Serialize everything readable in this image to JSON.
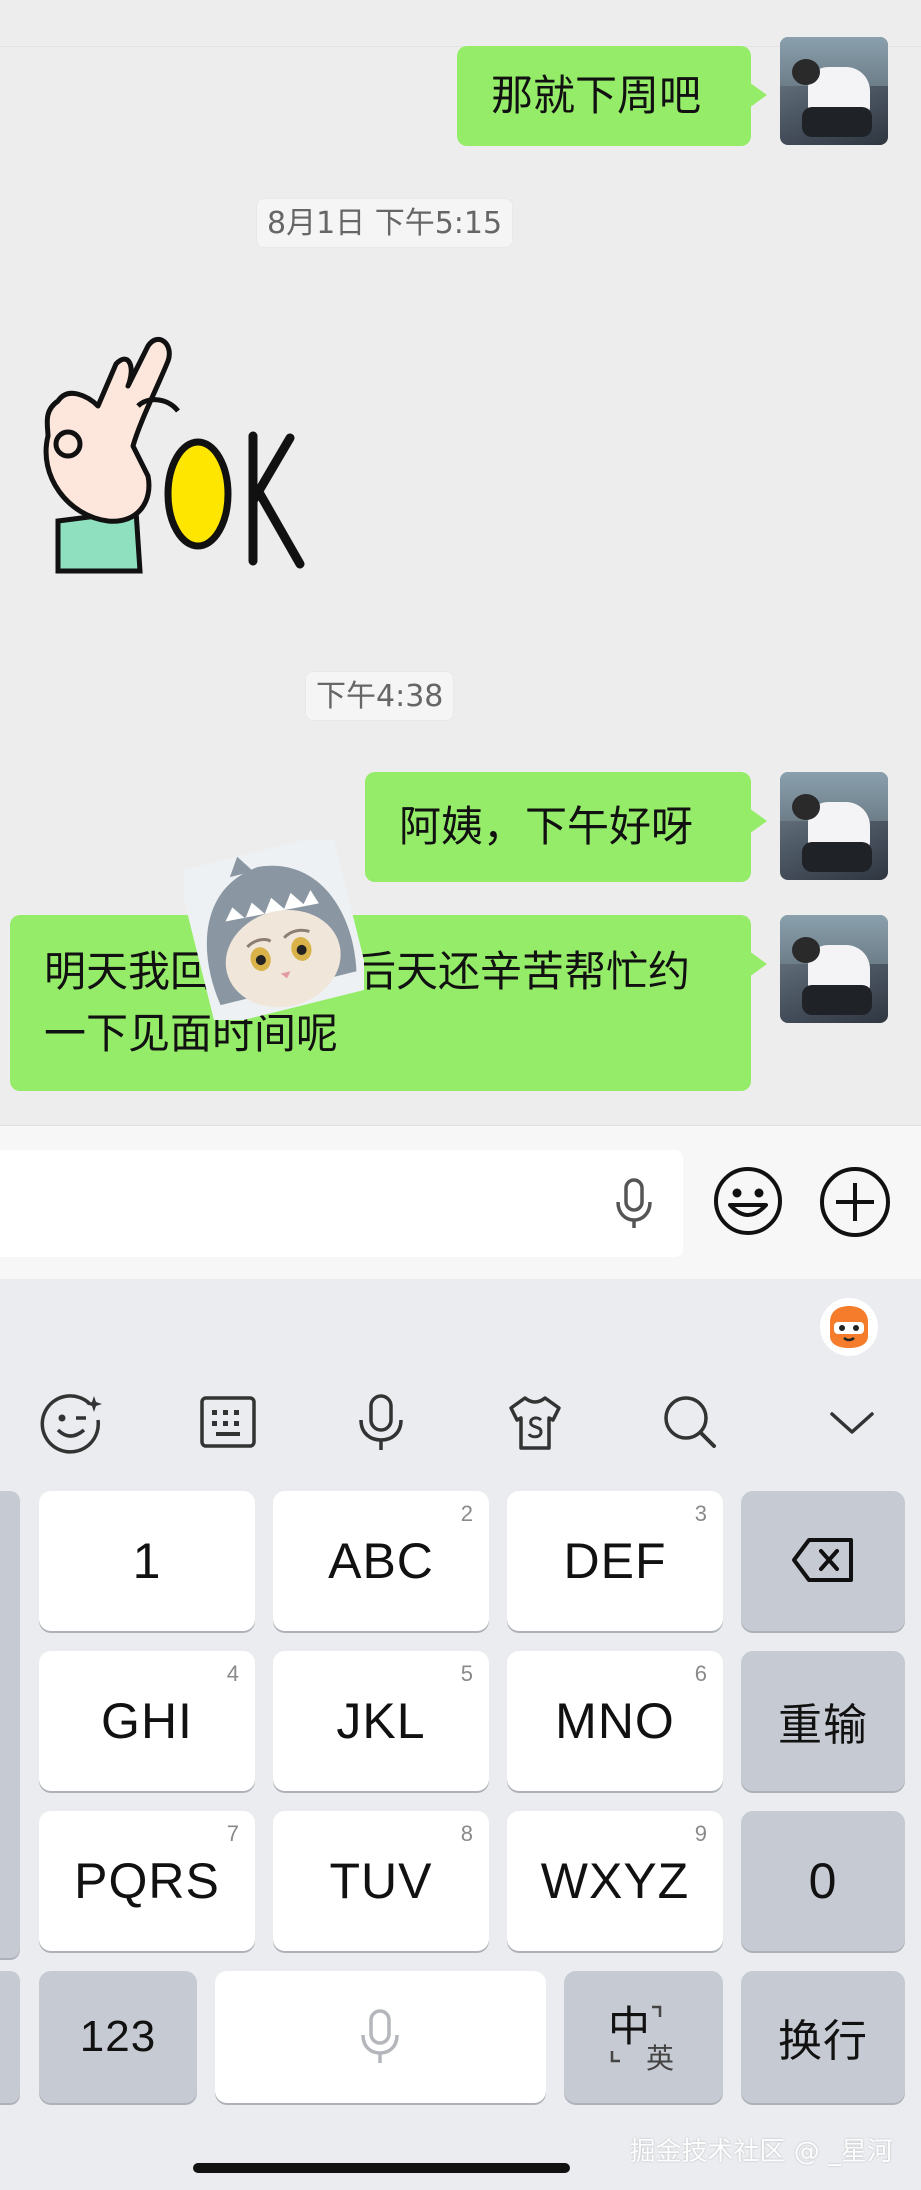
{
  "chat": {
    "top_cut_text": "",
    "messages": [
      {
        "text": "那就下周吧"
      },
      {
        "text": "阿姨，下午好呀"
      },
      {
        "line1": "明天我回",
        "line1_right": "后天还辛苦帮忙约",
        "line2": "一下见面时间呢"
      }
    ],
    "timestamps": [
      "8月1日 下午5:15",
      "下午4:38"
    ],
    "stickers": {
      "ok_text": "OK"
    }
  },
  "input_bar": {
    "placeholder": ""
  },
  "keyboard": {
    "keys": {
      "k1": {
        "label": "1",
        "hint": ""
      },
      "k2": {
        "label": "ABC",
        "hint": "2"
      },
      "k3": {
        "label": "DEF",
        "hint": "3"
      },
      "k4": {
        "label": "GHI",
        "hint": "4"
      },
      "k5": {
        "label": "JKL",
        "hint": "5"
      },
      "k6": {
        "label": "MNO",
        "hint": "6"
      },
      "k7": {
        "label": "PQRS",
        "hint": "7"
      },
      "k8": {
        "label": "TUV",
        "hint": "8"
      },
      "k9": {
        "label": "WXYZ",
        "hint": "9"
      },
      "reset": "重输",
      "zero": "0",
      "num123": "123",
      "lang_main": "中",
      "lang_sub": "英",
      "return": "换行"
    }
  },
  "watermark": "掘金技术社区 @ _星河",
  "colors": {
    "bubble": "#95ec69",
    "chat_bg": "#ededed",
    "keyboard_bg": "#eaecf0"
  }
}
